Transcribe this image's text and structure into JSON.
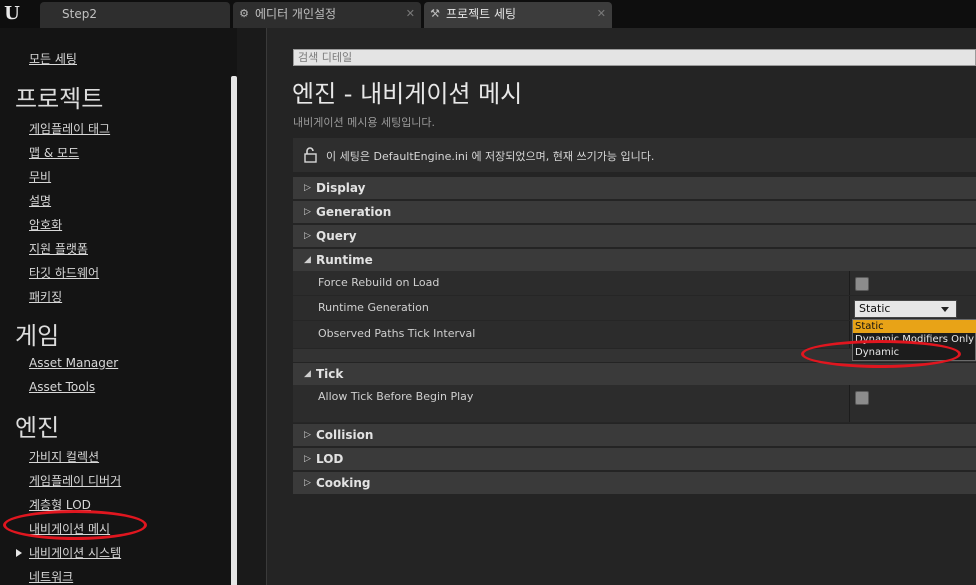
{
  "tabs": [
    {
      "label": "Step2",
      "icon": "",
      "active": false
    },
    {
      "label": "에디터 개인설정",
      "icon": "editor-icon",
      "active": false
    },
    {
      "label": "프로젝트 세팅",
      "icon": "project-settings-icon",
      "active": true
    }
  ],
  "sidebar": {
    "all_settings": "모든 세팅",
    "sections": [
      {
        "title": "프로젝트",
        "items": [
          "게임플레이 태그",
          "맵 & 모드",
          "무비",
          "설명",
          "암호화",
          "지원 플랫폼",
          "타깃 하드웨어",
          "패키징"
        ]
      },
      {
        "title": "게임",
        "items": [
          "Asset Manager",
          "Asset Tools"
        ]
      },
      {
        "title": "엔진",
        "items": [
          "가비지 컬렉션",
          "게임플레이 디버거",
          "계층형 LOD",
          "내비게이션 메시",
          "내비게이션 시스템",
          "네트워크"
        ]
      }
    ],
    "selected": "내비게이션 메시"
  },
  "main": {
    "search_placeholder": "검색 디테일",
    "title": "엔진 - 내비게이션 메시",
    "subtitle": "내비게이션 메시용 세팅입니다.",
    "info": "이 세팅은 DefaultEngine.ini 에 저장되었으며, 현재 쓰기가능 입니다.",
    "categories": {
      "display": "Display",
      "generation": "Generation",
      "query": "Query",
      "runtime": "Runtime",
      "tick": "Tick",
      "collision": "Collision",
      "lod": "LOD",
      "cooking": "Cooking"
    },
    "properties": {
      "force_rebuild": "Force Rebuild on Load",
      "runtime_generation": "Runtime Generation",
      "observed_paths": "Observed Paths Tick Interval",
      "allow_tick": "Allow Tick Before Begin Play"
    },
    "runtime_generation_value": "Static",
    "dropdown_options": [
      "Static",
      "Dynamic Modifiers Only",
      "Dynamic"
    ],
    "highlight_color": "#e8a317",
    "annotation_color": "#e0161f"
  }
}
